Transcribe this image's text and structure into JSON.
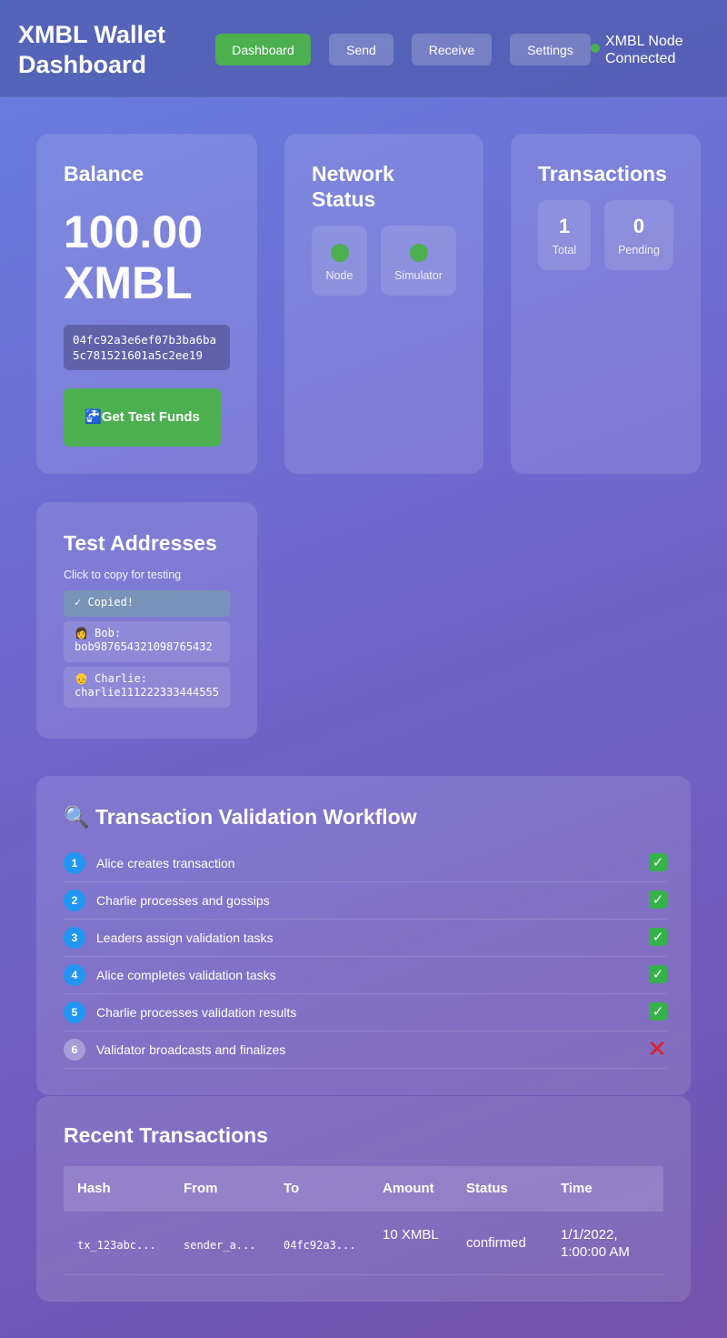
{
  "header": {
    "title": "XMBL Wallet Dashboard",
    "nav": [
      "Dashboard",
      "Send",
      "Receive",
      "Settings"
    ],
    "active_nav": "Dashboard",
    "node_status": "XMBL Node Connected"
  },
  "balance": {
    "title": "Balance",
    "amount": "100.00 XMBL",
    "address": "04fc92a3e6ef07b3ba6ba5c781521601a5c2ee19",
    "faucet_label": "🚰Get Test Funds"
  },
  "network": {
    "title": "Network Status",
    "items": [
      {
        "label": "Node",
        "status": "online"
      },
      {
        "label": "Simulator",
        "status": "online"
      }
    ]
  },
  "transactions_stats": {
    "title": "Transactions",
    "total": "1",
    "total_label": "Total",
    "pending": "0",
    "pending_label": "Pending"
  },
  "test_addresses": {
    "title": "Test Addresses",
    "hint": "Click to copy for testing",
    "items": [
      "✓ Copied!",
      "👩 Bob: bob987654321098765432",
      "👴 Charlie: charlie111222333444555"
    ]
  },
  "workflow": {
    "title": "🔍 Transaction Validation Workflow",
    "steps": [
      {
        "num": "1",
        "label": "Alice creates transaction",
        "done": true
      },
      {
        "num": "2",
        "label": "Charlie processes and gossips",
        "done": true
      },
      {
        "num": "3",
        "label": "Leaders assign validation tasks",
        "done": true
      },
      {
        "num": "4",
        "label": "Alice completes validation tasks",
        "done": true
      },
      {
        "num": "5",
        "label": "Charlie processes validation results",
        "done": true
      },
      {
        "num": "6",
        "label": "Validator broadcasts and finalizes",
        "done": false
      }
    ],
    "done_icon": "✓",
    "fail_icon": "✕"
  },
  "recent": {
    "title": "Recent Transactions",
    "columns": [
      "Hash",
      "From",
      "To",
      "Amount",
      "Status",
      "Time"
    ],
    "rows": [
      {
        "hash": "tx_123abc...",
        "from": "sender_a...",
        "to": "04fc92a3...",
        "amount": "10 XMBL",
        "status": "confirmed",
        "time": "1/1/2022, 1:00:00 AM"
      }
    ]
  },
  "colors": {
    "accent_green": "#4caf50",
    "step_blue": "#2196f3",
    "error_red": "#e01e1e"
  }
}
